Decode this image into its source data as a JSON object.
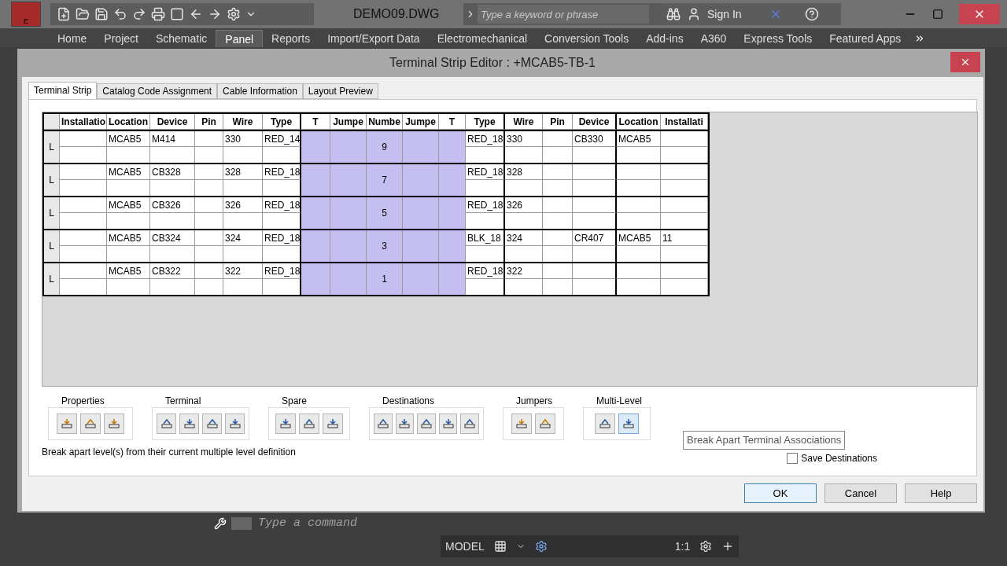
{
  "app": {
    "file_title": "DEMO09.DWG",
    "search_placeholder": "Type a keyword or phrase",
    "sign_in": "Sign In",
    "app_menu_letter": "E"
  },
  "ribbon_tabs": [
    {
      "label": "Home",
      "selected": false
    },
    {
      "label": "Project",
      "selected": false
    },
    {
      "label": "Schematic",
      "selected": false
    },
    {
      "label": "Panel",
      "selected": true
    },
    {
      "label": "Reports",
      "selected": false
    },
    {
      "label": "Import/Export Data",
      "selected": false
    },
    {
      "label": "Electromechanical",
      "selected": false
    },
    {
      "label": "Conversion Tools",
      "selected": false
    },
    {
      "label": "Add-ins",
      "selected": false
    },
    {
      "label": "A360",
      "selected": false
    },
    {
      "label": "Express Tools",
      "selected": false
    },
    {
      "label": "Featured Apps",
      "selected": false
    }
  ],
  "dialog": {
    "title": "Terminal Strip Editor : +MCAB5-TB-1",
    "tabs": [
      {
        "label": "Terminal Strip",
        "selected": true
      },
      {
        "label": "Catalog Code Assignment",
        "selected": false
      },
      {
        "label": "Cable Information",
        "selected": false
      },
      {
        "label": "Layout Preview",
        "selected": false
      }
    ],
    "table": {
      "columns": [
        "Installatio",
        "Location",
        "Device",
        "Pin",
        "Wire",
        "Type",
        "T",
        "Jumpe",
        "Numbe",
        "Jumpe",
        "T",
        "Type",
        "Wire",
        "Pin",
        "Device",
        "Location",
        "Installati"
      ],
      "rows": [
        {
          "header": "L",
          "location": "MCAB5",
          "device": "M414",
          "wire": "330",
          "type": "RED_14",
          "number": "9",
          "dest_type": "RED_18",
          "dest_wire": "330",
          "dest_device": "CB330",
          "dest_location": "MCAB5"
        },
        {
          "header": "L",
          "location": "MCAB5",
          "device": "CB328",
          "wire": "328",
          "type": "RED_18",
          "number": "7",
          "dest_type": "RED_18",
          "dest_wire": "328"
        },
        {
          "header": "L",
          "location": "MCAB5",
          "device": "CB326",
          "wire": "326",
          "type": "RED_18",
          "number": "5",
          "dest_type": "RED_18",
          "dest_wire": "326"
        },
        {
          "header": "L",
          "location": "MCAB5",
          "device": "CB324",
          "wire": "324",
          "type": "RED_18",
          "number": "3",
          "dest_type": "BLK_18",
          "dest_wire": "324",
          "dest_device": "CR407",
          "dest_location": "MCAB5",
          "dest_installation": "11"
        },
        {
          "header": "L",
          "location": "MCAB5",
          "device": "CB322",
          "wire": "322",
          "type": "RED_18",
          "number": "1",
          "dest_type": "RED_18",
          "dest_wire": "322"
        }
      ]
    },
    "tool_groups": [
      {
        "title": "Properties"
      },
      {
        "title": "Terminal"
      },
      {
        "title": "Spare"
      },
      {
        "title": "Destinations"
      },
      {
        "title": "Jumpers"
      },
      {
        "title": "Multi-Level"
      }
    ],
    "status_text": "Break apart level(s) from their current multiple level definition",
    "tooltip": "Break Apart Terminal Associations",
    "save_destinations": {
      "label": "Save Destinations",
      "checked": false
    },
    "buttons": [
      "OK",
      "Cancel",
      "Help"
    ]
  },
  "command_line": {
    "placeholder": "Type a command"
  },
  "status_bar": {
    "model": "MODEL",
    "scale": "1:1"
  }
}
